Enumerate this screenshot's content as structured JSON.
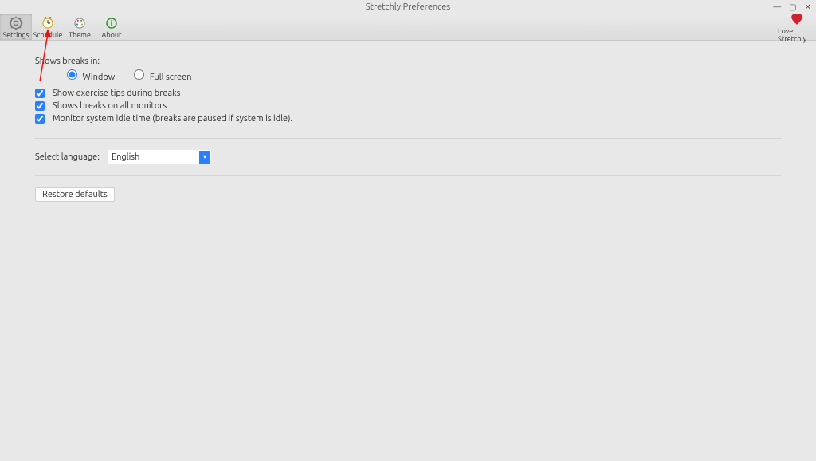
{
  "window": {
    "title": "Stretchly Preferences"
  },
  "toolbar": {
    "settings": "Settings",
    "schedule": "Schedule",
    "theme": "Theme",
    "about": "About",
    "love": "Love Stretchly"
  },
  "breaks": {
    "heading": "Shows breaks in:",
    "radio_window": "Window",
    "radio_fullscreen": "Full screen",
    "cb_tips": "Show exercise tips during breaks",
    "cb_allmon": "Shows breaks on all monitors",
    "cb_idle": "Monitor system idle time (breaks are paused if system is idle)."
  },
  "language": {
    "label": "Select language:",
    "value": "English"
  },
  "actions": {
    "restore": "Restore defaults"
  }
}
